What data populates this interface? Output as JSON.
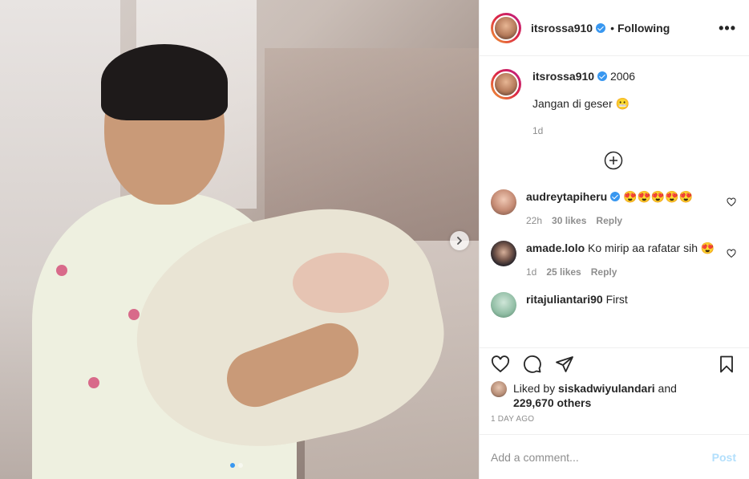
{
  "header": {
    "username": "itsrossa910",
    "separator": "•",
    "follow_label": "Following",
    "more_label": "•••"
  },
  "caption": {
    "username": "itsrossa910",
    "title": "2006",
    "text": "Jangan di geser 😬",
    "time": "1d"
  },
  "comments": [
    {
      "username": "audreytapiheru",
      "verified": true,
      "text": "😍😍😍😍😍",
      "time": "22h",
      "likes": "30 likes",
      "reply": "Reply"
    },
    {
      "username": "amade.lolo",
      "verified": false,
      "text": "Ko mirip aa rafatar sih 😍",
      "time": "1d",
      "likes": "25 likes",
      "reply": "Reply"
    },
    {
      "username": "ritajuliantari90",
      "verified": false,
      "text": "First"
    }
  ],
  "likes": {
    "prefix": "Liked by",
    "user": "siskadwiyulandari",
    "and": "and",
    "others": "229,670 others"
  },
  "timeago": "1 DAY AGO",
  "add_comment": {
    "placeholder": "Add a comment...",
    "post_label": "Post"
  },
  "carousel": {
    "total": 2,
    "current": 1
  },
  "colors": {
    "accent": "#3897f0",
    "post_disabled": "#b2dffc",
    "muted": "#8e8e8e"
  }
}
